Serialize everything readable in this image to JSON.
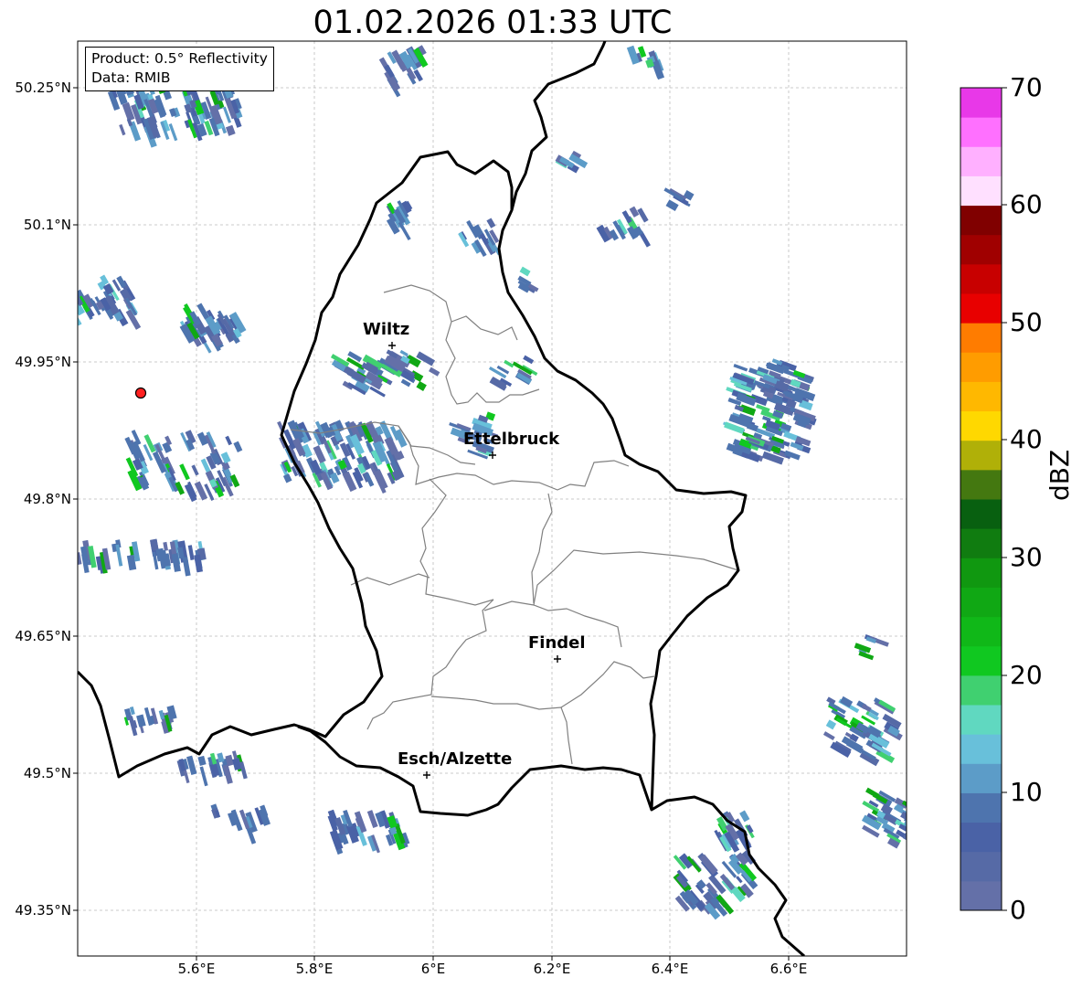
{
  "title": "01.02.2026 01:33 UTC",
  "info": {
    "product": "Product: 0.5° Reflectivity",
    "data": "Data: RMIB"
  },
  "map": {
    "lon_range": [
      5.4,
      6.8
    ],
    "lat_range": [
      49.3,
      50.3
    ],
    "lat_ticks": [
      {
        "value": 50.25,
        "label": "50.25°N"
      },
      {
        "value": 50.1,
        "label": "50.1°N"
      },
      {
        "value": 49.95,
        "label": "49.95°N"
      },
      {
        "value": 49.8,
        "label": "49.8°N"
      },
      {
        "value": 49.65,
        "label": "49.65°N"
      },
      {
        "value": 49.5,
        "label": "49.5°N"
      },
      {
        "value": 49.35,
        "label": "49.35°N"
      }
    ],
    "lon_ticks": [
      {
        "value": 5.6,
        "label": "5.6°E"
      },
      {
        "value": 5.8,
        "label": "5.8°E"
      },
      {
        "value": 6.0,
        "label": "6°E"
      },
      {
        "value": 6.2,
        "label": "6.2°E"
      },
      {
        "value": 6.4,
        "label": "6.4°E"
      },
      {
        "value": 6.6,
        "label": "6.6°E"
      }
    ],
    "cities": [
      {
        "name": "Wiltz",
        "lon": 5.932,
        "lat": 49.966
      },
      {
        "name": "Ettelbruck",
        "lon": 6.104,
        "lat": 49.847
      },
      {
        "name": "Findel",
        "lon": 6.211,
        "lat": 49.626
      },
      {
        "name": "Esch/Alzette",
        "lon": 5.98,
        "lat": 49.496
      }
    ],
    "radar_site": {
      "lon": 5.505,
      "lat": 49.914
    }
  },
  "colorbar": {
    "label": "dBZ",
    "ticks": [
      "0",
      "10",
      "20",
      "30",
      "40",
      "50",
      "60",
      "70"
    ],
    "colors": [
      "#6470a8",
      "#566aa6",
      "#4a62a6",
      "#4e74ae",
      "#5c9cc8",
      "#68c0da",
      "#60d8c0",
      "#40d070",
      "#10c820",
      "#10b818",
      "#10a814",
      "#109810",
      "#107c10",
      "#086010",
      "#447810",
      "#b0b008",
      "#ffd800",
      "#ffb800",
      "#ff9c00",
      "#ff7c00",
      "#e80000",
      "#c80000",
      "#a00000",
      "#800000",
      "#ffe0ff",
      "#ffb0ff",
      "#ff70ff",
      "#e838e8"
    ]
  }
}
